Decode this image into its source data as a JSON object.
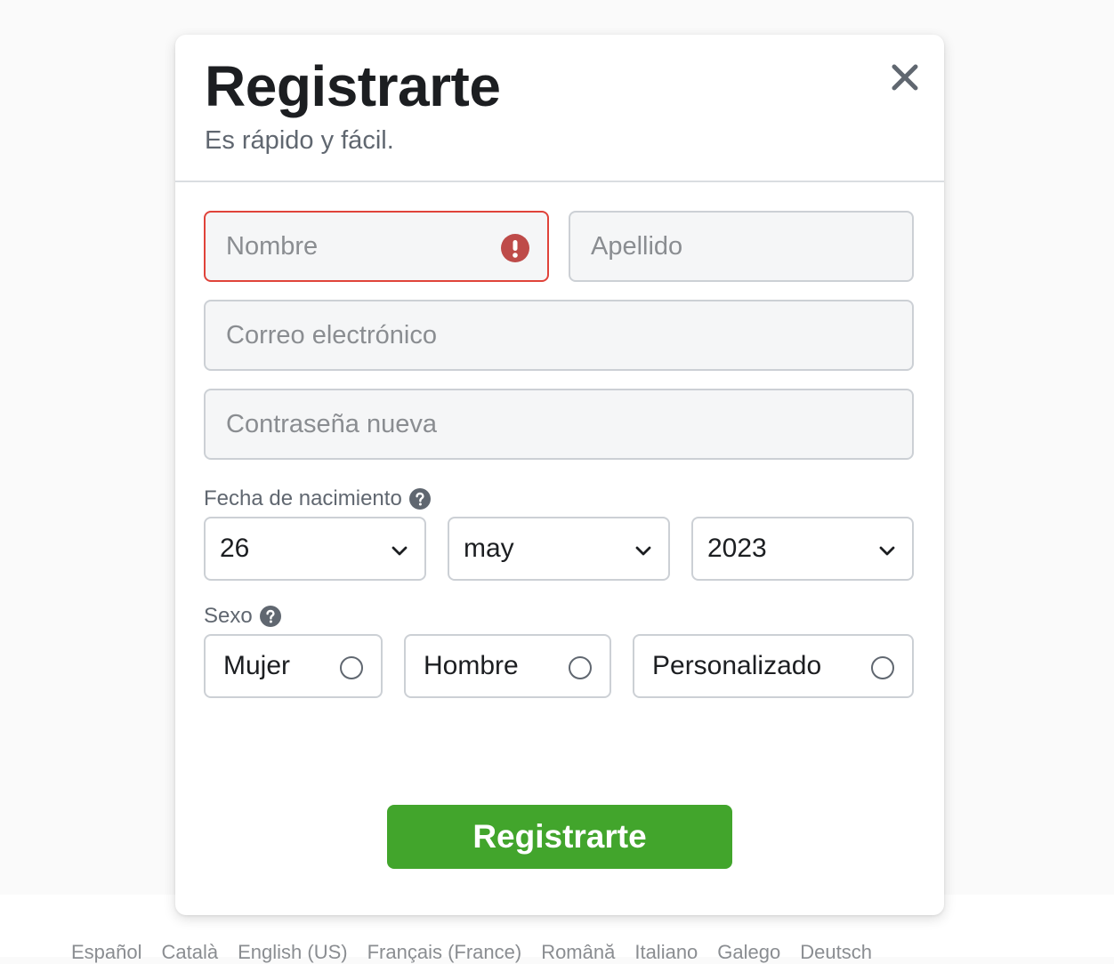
{
  "footer": {
    "languages": [
      "Español",
      "Català",
      "English (US)",
      "Français (France)",
      "Română",
      "Italiano",
      "Galego",
      "Deutsch"
    ]
  },
  "modal": {
    "title": "Registrarte",
    "subtitle": "Es rápido y fácil."
  },
  "form": {
    "first_name_placeholder": "Nombre",
    "last_name_placeholder": "Apellido",
    "email_placeholder": "Correo electrónico",
    "password_placeholder": "Contraseña nueva",
    "birthday_label": "Fecha de nacimiento",
    "birthday": {
      "day": "26",
      "month": "may",
      "year": "2023"
    },
    "gender_label": "Sexo",
    "gender_options": [
      "Mujer",
      "Hombre",
      "Personalizado"
    ],
    "submit_label": "Registrarte"
  },
  "colors": {
    "accent_green": "#42a52c",
    "error_red": "#e0433a"
  }
}
